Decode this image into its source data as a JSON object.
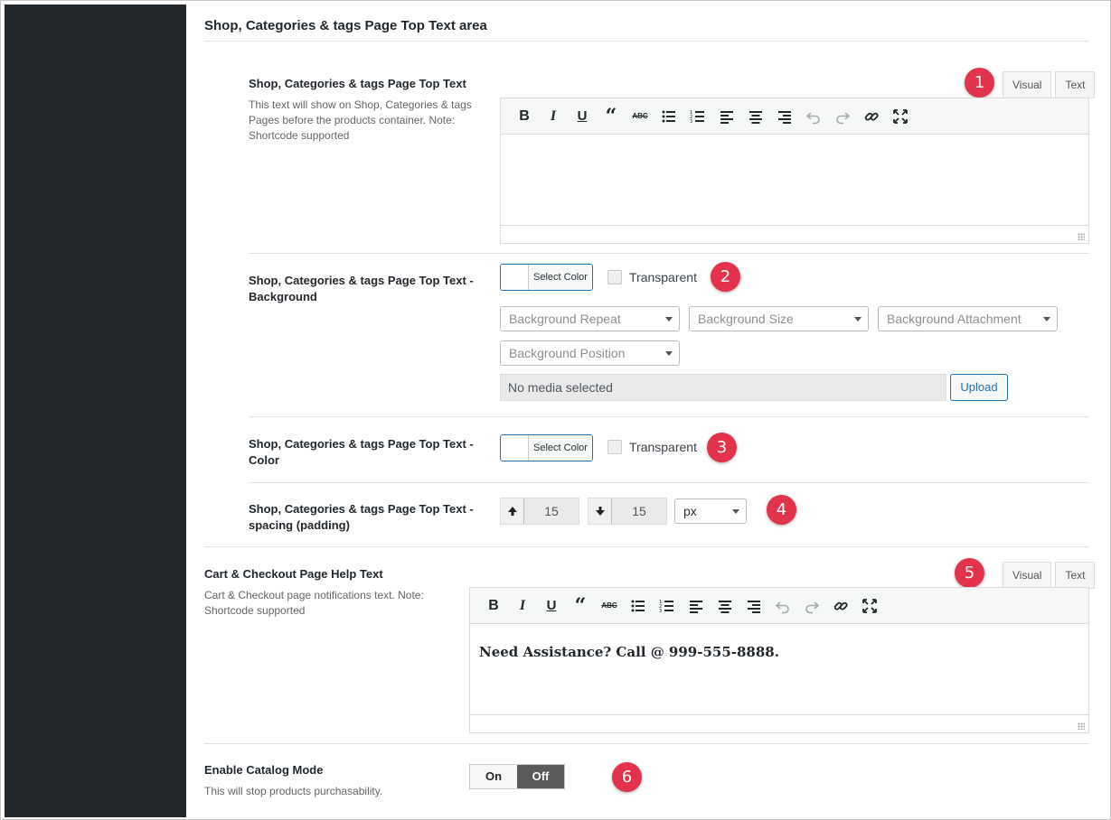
{
  "section": {
    "title": "Shop, Categories & tags Page Top Text area"
  },
  "top_text": {
    "label": "Shop, Categories & tags Page Top Text",
    "description": "This text will show on Shop, Categories & tags Pages before the products container. Note: Shortcode supported",
    "tab_visual": "Visual",
    "tab_text": "Text",
    "content": ""
  },
  "background": {
    "label": "Shop, Categories & tags Page Top Text - Background",
    "select_color": "Select Color",
    "transparent": "Transparent",
    "repeat_placeholder": "Background Repeat",
    "size_placeholder": "Background Size",
    "attachment_placeholder": "Background Attachment",
    "position_placeholder": "Background Position",
    "media_text": "No media selected",
    "upload_label": "Upload"
  },
  "color": {
    "label": "Shop, Categories & tags Page Top Text - Color",
    "select_color": "Select Color",
    "transparent": "Transparent"
  },
  "spacing": {
    "label": "Shop, Categories & tags Page Top Text - spacing (padding)",
    "top": "15",
    "bottom": "15",
    "unit": "px"
  },
  "cart": {
    "label": "Cart & Checkout Page Help Text",
    "description": "Cart & Checkout page notifications text. Note: Shortcode supported",
    "tab_visual": "Visual",
    "tab_text": "Text",
    "content": "Need Assistance? Call @ 999-555-8888."
  },
  "catalog": {
    "label": "Enable Catalog Mode",
    "description": "This will stop products purchasability.",
    "on": "On",
    "off": "Off"
  },
  "badges": [
    "1",
    "2",
    "3",
    "4",
    "5",
    "6"
  ],
  "colors": {
    "badge": "#e3324b",
    "sidebar": "#23282d",
    "accent": "#2271b1"
  }
}
